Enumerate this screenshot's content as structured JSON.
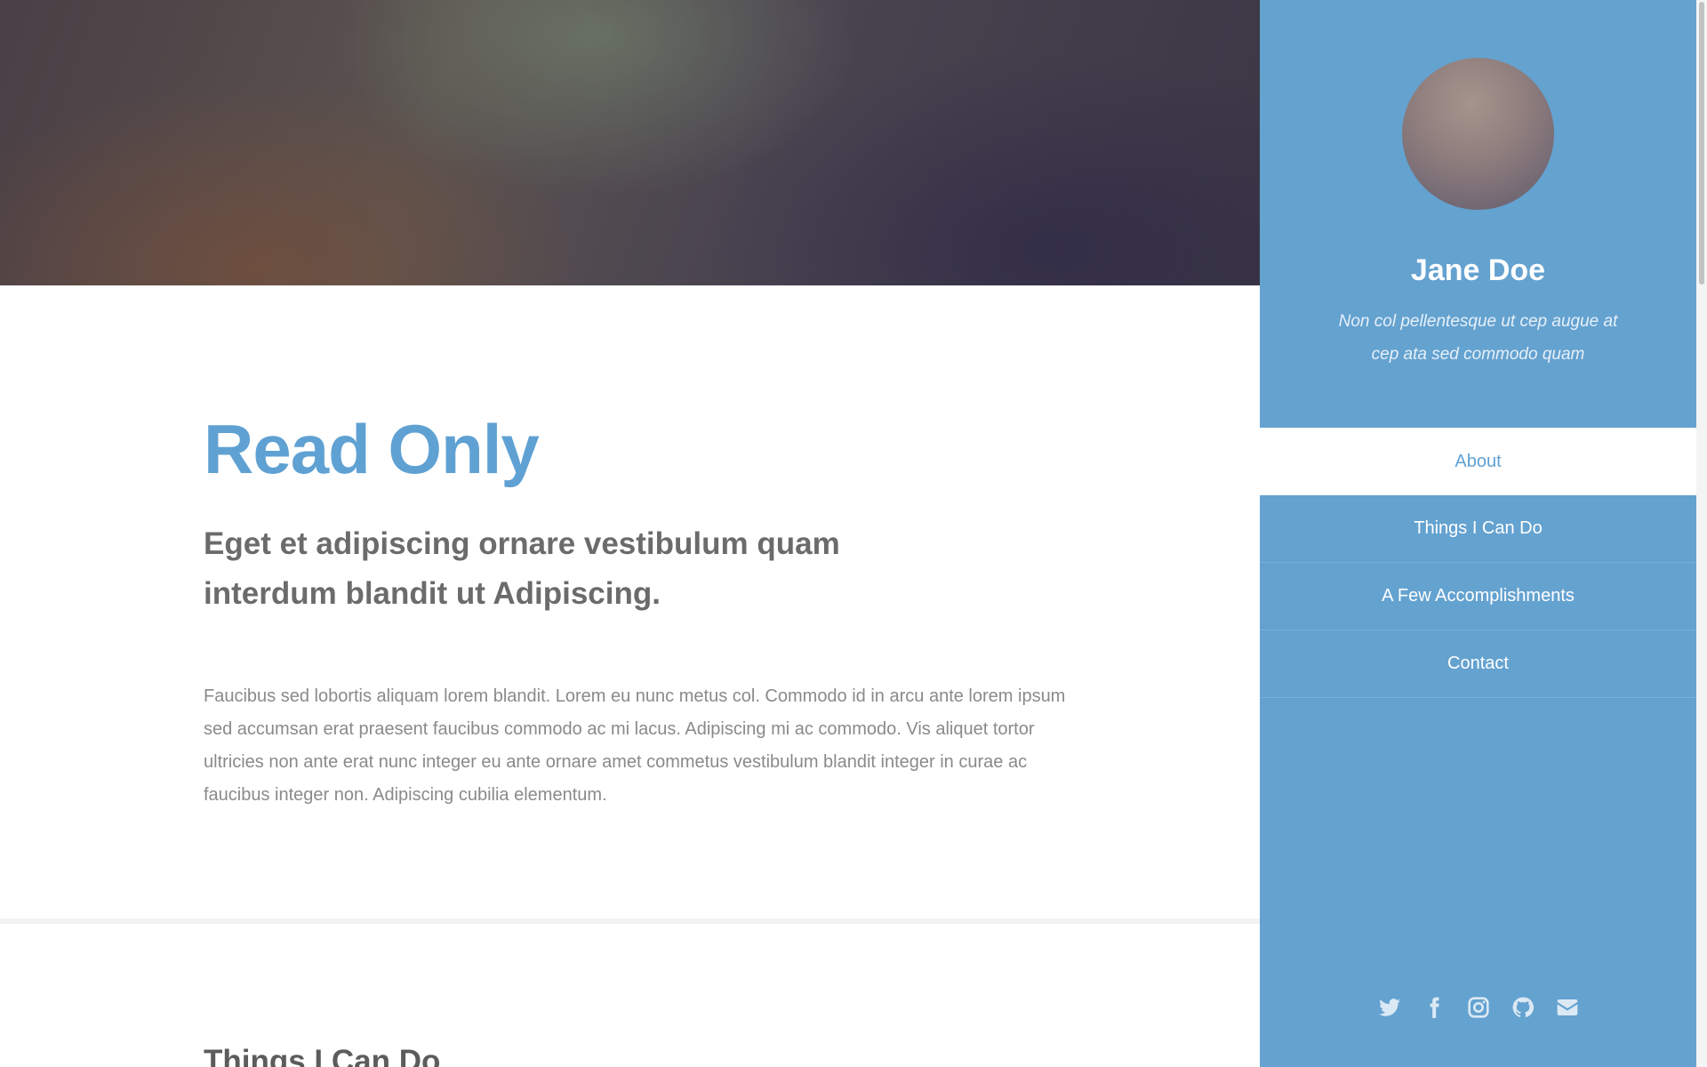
{
  "main": {
    "about": {
      "title": "Read Only",
      "subtitle": "Eget et adipiscing ornare vestibulum quam interdum blandit ut Adipiscing.",
      "body": "Faucibus sed lobortis aliquam lorem blandit. Lorem eu nunc metus col. Commodo id in arcu ante lorem ipsum sed accumsan erat praesent faucibus commodo ac mi lacus. Adipiscing mi ac commodo. Vis aliquet tortor ultricies non ante erat nunc integer eu ante ornare amet commetus vestibulum blandit integer in curae ac faucibus integer non. Adipiscing cubilia elementum."
    },
    "next_section_title": "Things I Can Do"
  },
  "sidebar": {
    "name": "Jane Doe",
    "tagline": "Non col pellentesque ut cep augue at cep ata sed commodo quam",
    "nav": [
      {
        "label": "About",
        "active": true
      },
      {
        "label": "Things I Can Do",
        "active": false
      },
      {
        "label": "A Few Accomplishments",
        "active": false
      },
      {
        "label": "Contact",
        "active": false
      }
    ],
    "socials": [
      "twitter-icon",
      "facebook-icon",
      "instagram-icon",
      "github-icon",
      "envelope-icon"
    ]
  },
  "colors": {
    "accent": "#5fa1d3",
    "sidebar_bg": "#64a2d0",
    "heading_gray": "#6b6b6b",
    "body_gray": "#8a8a8a"
  }
}
